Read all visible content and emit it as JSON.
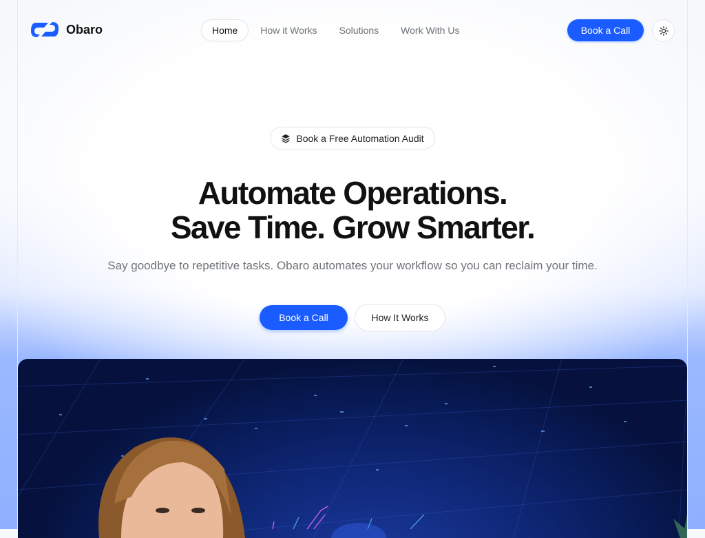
{
  "brand": {
    "name": "Obaro",
    "accent": "#1a5cff"
  },
  "nav": {
    "items": [
      {
        "label": "Home",
        "active": true
      },
      {
        "label": "How it Works",
        "active": false
      },
      {
        "label": "Solutions",
        "active": false
      },
      {
        "label": "Work With Us",
        "active": false
      }
    ]
  },
  "header": {
    "cta_label": "Book a Call",
    "theme_icon": "sun-icon"
  },
  "hero": {
    "badge_icon": "layers-icon",
    "badge_label": "Book a Free Automation Audit",
    "title_line1": "Automate Operations.",
    "title_line2": "Save Time. Grow Smarter.",
    "subtitle": "Say goodbye to repetitive tasks. Obaro automates your workflow so you can reclaim your time.",
    "primary_cta": "Book a Call",
    "secondary_cta": "How It Works"
  },
  "showcase": {
    "media": "presenter-video-frame"
  }
}
